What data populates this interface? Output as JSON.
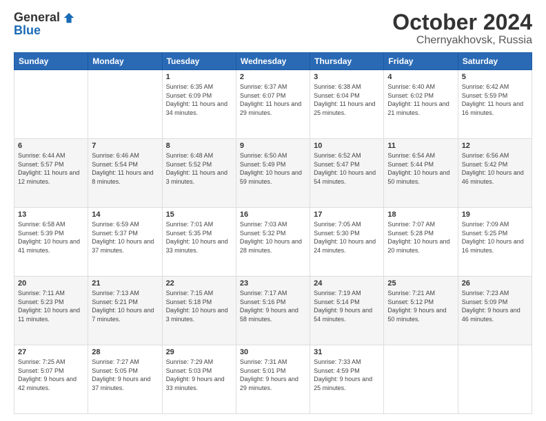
{
  "logo": {
    "general": "General",
    "blue": "Blue"
  },
  "title": {
    "month_year": "October 2024",
    "location": "Chernyakhovsk, Russia"
  },
  "weekdays": [
    "Sunday",
    "Monday",
    "Tuesday",
    "Wednesday",
    "Thursday",
    "Friday",
    "Saturday"
  ],
  "weeks": [
    [
      {
        "day": "",
        "sunrise": "",
        "sunset": "",
        "daylight": ""
      },
      {
        "day": "",
        "sunrise": "",
        "sunset": "",
        "daylight": ""
      },
      {
        "day": "1",
        "sunrise": "Sunrise: 6:35 AM",
        "sunset": "Sunset: 6:09 PM",
        "daylight": "Daylight: 11 hours and 34 minutes."
      },
      {
        "day": "2",
        "sunrise": "Sunrise: 6:37 AM",
        "sunset": "Sunset: 6:07 PM",
        "daylight": "Daylight: 11 hours and 29 minutes."
      },
      {
        "day": "3",
        "sunrise": "Sunrise: 6:38 AM",
        "sunset": "Sunset: 6:04 PM",
        "daylight": "Daylight: 11 hours and 25 minutes."
      },
      {
        "day": "4",
        "sunrise": "Sunrise: 6:40 AM",
        "sunset": "Sunset: 6:02 PM",
        "daylight": "Daylight: 11 hours and 21 minutes."
      },
      {
        "day": "5",
        "sunrise": "Sunrise: 6:42 AM",
        "sunset": "Sunset: 5:59 PM",
        "daylight": "Daylight: 11 hours and 16 minutes."
      }
    ],
    [
      {
        "day": "6",
        "sunrise": "Sunrise: 6:44 AM",
        "sunset": "Sunset: 5:57 PM",
        "daylight": "Daylight: 11 hours and 12 minutes."
      },
      {
        "day": "7",
        "sunrise": "Sunrise: 6:46 AM",
        "sunset": "Sunset: 5:54 PM",
        "daylight": "Daylight: 11 hours and 8 minutes."
      },
      {
        "day": "8",
        "sunrise": "Sunrise: 6:48 AM",
        "sunset": "Sunset: 5:52 PM",
        "daylight": "Daylight: 11 hours and 3 minutes."
      },
      {
        "day": "9",
        "sunrise": "Sunrise: 6:50 AM",
        "sunset": "Sunset: 5:49 PM",
        "daylight": "Daylight: 10 hours and 59 minutes."
      },
      {
        "day": "10",
        "sunrise": "Sunrise: 6:52 AM",
        "sunset": "Sunset: 5:47 PM",
        "daylight": "Daylight: 10 hours and 54 minutes."
      },
      {
        "day": "11",
        "sunrise": "Sunrise: 6:54 AM",
        "sunset": "Sunset: 5:44 PM",
        "daylight": "Daylight: 10 hours and 50 minutes."
      },
      {
        "day": "12",
        "sunrise": "Sunrise: 6:56 AM",
        "sunset": "Sunset: 5:42 PM",
        "daylight": "Daylight: 10 hours and 46 minutes."
      }
    ],
    [
      {
        "day": "13",
        "sunrise": "Sunrise: 6:58 AM",
        "sunset": "Sunset: 5:39 PM",
        "daylight": "Daylight: 10 hours and 41 minutes."
      },
      {
        "day": "14",
        "sunrise": "Sunrise: 6:59 AM",
        "sunset": "Sunset: 5:37 PM",
        "daylight": "Daylight: 10 hours and 37 minutes."
      },
      {
        "day": "15",
        "sunrise": "Sunrise: 7:01 AM",
        "sunset": "Sunset: 5:35 PM",
        "daylight": "Daylight: 10 hours and 33 minutes."
      },
      {
        "day": "16",
        "sunrise": "Sunrise: 7:03 AM",
        "sunset": "Sunset: 5:32 PM",
        "daylight": "Daylight: 10 hours and 28 minutes."
      },
      {
        "day": "17",
        "sunrise": "Sunrise: 7:05 AM",
        "sunset": "Sunset: 5:30 PM",
        "daylight": "Daylight: 10 hours and 24 minutes."
      },
      {
        "day": "18",
        "sunrise": "Sunrise: 7:07 AM",
        "sunset": "Sunset: 5:28 PM",
        "daylight": "Daylight: 10 hours and 20 minutes."
      },
      {
        "day": "19",
        "sunrise": "Sunrise: 7:09 AM",
        "sunset": "Sunset: 5:25 PM",
        "daylight": "Daylight: 10 hours and 16 minutes."
      }
    ],
    [
      {
        "day": "20",
        "sunrise": "Sunrise: 7:11 AM",
        "sunset": "Sunset: 5:23 PM",
        "daylight": "Daylight: 10 hours and 11 minutes."
      },
      {
        "day": "21",
        "sunrise": "Sunrise: 7:13 AM",
        "sunset": "Sunset: 5:21 PM",
        "daylight": "Daylight: 10 hours and 7 minutes."
      },
      {
        "day": "22",
        "sunrise": "Sunrise: 7:15 AM",
        "sunset": "Sunset: 5:18 PM",
        "daylight": "Daylight: 10 hours and 3 minutes."
      },
      {
        "day": "23",
        "sunrise": "Sunrise: 7:17 AM",
        "sunset": "Sunset: 5:16 PM",
        "daylight": "Daylight: 9 hours and 58 minutes."
      },
      {
        "day": "24",
        "sunrise": "Sunrise: 7:19 AM",
        "sunset": "Sunset: 5:14 PM",
        "daylight": "Daylight: 9 hours and 54 minutes."
      },
      {
        "day": "25",
        "sunrise": "Sunrise: 7:21 AM",
        "sunset": "Sunset: 5:12 PM",
        "daylight": "Daylight: 9 hours and 50 minutes."
      },
      {
        "day": "26",
        "sunrise": "Sunrise: 7:23 AM",
        "sunset": "Sunset: 5:09 PM",
        "daylight": "Daylight: 9 hours and 46 minutes."
      }
    ],
    [
      {
        "day": "27",
        "sunrise": "Sunrise: 7:25 AM",
        "sunset": "Sunset: 5:07 PM",
        "daylight": "Daylight: 9 hours and 42 minutes."
      },
      {
        "day": "28",
        "sunrise": "Sunrise: 7:27 AM",
        "sunset": "Sunset: 5:05 PM",
        "daylight": "Daylight: 9 hours and 37 minutes."
      },
      {
        "day": "29",
        "sunrise": "Sunrise: 7:29 AM",
        "sunset": "Sunset: 5:03 PM",
        "daylight": "Daylight: 9 hours and 33 minutes."
      },
      {
        "day": "30",
        "sunrise": "Sunrise: 7:31 AM",
        "sunset": "Sunset: 5:01 PM",
        "daylight": "Daylight: 9 hours and 29 minutes."
      },
      {
        "day": "31",
        "sunrise": "Sunrise: 7:33 AM",
        "sunset": "Sunset: 4:59 PM",
        "daylight": "Daylight: 9 hours and 25 minutes."
      },
      {
        "day": "",
        "sunrise": "",
        "sunset": "",
        "daylight": ""
      },
      {
        "day": "",
        "sunrise": "",
        "sunset": "",
        "daylight": ""
      }
    ]
  ]
}
